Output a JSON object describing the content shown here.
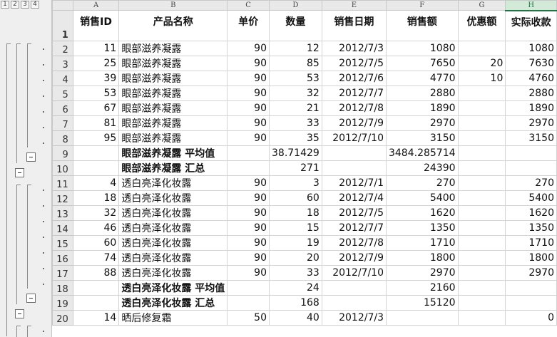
{
  "outline": {
    "levels": [
      "1",
      "2",
      "3",
      "4"
    ]
  },
  "columns": [
    "A",
    "B",
    "C",
    "D",
    "E",
    "F",
    "G",
    "H"
  ],
  "selected_column": "H",
  "header": {
    "row_number": "1",
    "cells": [
      "销售ID",
      "产品名称",
      "单价",
      "数量",
      "销售日期",
      "销售额",
      "优惠额",
      "实际收款"
    ]
  },
  "rows": [
    {
      "rn": "2",
      "kind": "data",
      "a": "11",
      "b": "眼部滋养凝露",
      "c": "90",
      "d": "12",
      "e": "2012/7/3",
      "f": "1080",
      "g": "",
      "h": "1080"
    },
    {
      "rn": "3",
      "kind": "data",
      "a": "25",
      "b": "眼部滋养凝露",
      "c": "90",
      "d": "85",
      "e": "2012/7/5",
      "f": "7650",
      "g": "20",
      "h": "7630"
    },
    {
      "rn": "4",
      "kind": "data",
      "a": "39",
      "b": "眼部滋养凝露",
      "c": "90",
      "d": "53",
      "e": "2012/7/6",
      "f": "4770",
      "g": "10",
      "h": "4760"
    },
    {
      "rn": "5",
      "kind": "data",
      "a": "53",
      "b": "眼部滋养凝露",
      "c": "90",
      "d": "32",
      "e": "2012/7/7",
      "f": "2880",
      "g": "",
      "h": "2880"
    },
    {
      "rn": "6",
      "kind": "data",
      "a": "67",
      "b": "眼部滋养凝露",
      "c": "90",
      "d": "21",
      "e": "2012/7/8",
      "f": "1890",
      "g": "",
      "h": "1890"
    },
    {
      "rn": "7",
      "kind": "data",
      "a": "81",
      "b": "眼部滋养凝露",
      "c": "90",
      "d": "33",
      "e": "2012/7/9",
      "f": "2970",
      "g": "",
      "h": "2970"
    },
    {
      "rn": "8",
      "kind": "data",
      "a": "95",
      "b": "眼部滋养凝露",
      "c": "90",
      "d": "35",
      "e": "2012/7/10",
      "f": "3150",
      "g": "",
      "h": "3150"
    },
    {
      "rn": "9",
      "kind": "sum",
      "a": "",
      "b": "眼部滋养凝露 平均值",
      "c": "",
      "d": "38.71429",
      "e": "",
      "f": "3484.285714",
      "g": "",
      "h": ""
    },
    {
      "rn": "10",
      "kind": "sum",
      "a": "",
      "b": "眼部滋养凝露 汇总",
      "c": "",
      "d": "271",
      "e": "",
      "f": "24390",
      "g": "",
      "h": ""
    },
    {
      "rn": "11",
      "kind": "data",
      "a": "4",
      "b": "透白亮泽化妆露",
      "c": "90",
      "d": "3",
      "e": "2012/7/1",
      "f": "270",
      "g": "",
      "h": "270"
    },
    {
      "rn": "12",
      "kind": "data",
      "a": "18",
      "b": "透白亮泽化妆露",
      "c": "90",
      "d": "60",
      "e": "2012/7/4",
      "f": "5400",
      "g": "",
      "h": "5400"
    },
    {
      "rn": "13",
      "kind": "data",
      "a": "32",
      "b": "透白亮泽化妆露",
      "c": "90",
      "d": "18",
      "e": "2012/7/5",
      "f": "1620",
      "g": "",
      "h": "1620"
    },
    {
      "rn": "14",
      "kind": "data",
      "a": "46",
      "b": "透白亮泽化妆露",
      "c": "90",
      "d": "15",
      "e": "2012/7/7",
      "f": "1350",
      "g": "",
      "h": "1350"
    },
    {
      "rn": "15",
      "kind": "data",
      "a": "60",
      "b": "透白亮泽化妆露",
      "c": "90",
      "d": "19",
      "e": "2012/7/8",
      "f": "1710",
      "g": "",
      "h": "1710"
    },
    {
      "rn": "16",
      "kind": "data",
      "a": "74",
      "b": "透白亮泽化妆露",
      "c": "90",
      "d": "20",
      "e": "2012/7/9",
      "f": "1800",
      "g": "",
      "h": "1800"
    },
    {
      "rn": "17",
      "kind": "data",
      "a": "88",
      "b": "透白亮泽化妆露",
      "c": "90",
      "d": "33",
      "e": "2012/7/10",
      "f": "2970",
      "g": "",
      "h": "2970"
    },
    {
      "rn": "18",
      "kind": "sum",
      "a": "",
      "b": "透白亮泽化妆露 平均值",
      "c": "",
      "d": "24",
      "e": "",
      "f": "2160",
      "g": "",
      "h": ""
    },
    {
      "rn": "19",
      "kind": "sum",
      "a": "",
      "b": "透白亮泽化妆露 汇总",
      "c": "",
      "d": "168",
      "e": "",
      "f": "15120",
      "g": "",
      "h": ""
    },
    {
      "rn": "20",
      "kind": "data",
      "a": "14",
      "b": "晒后修复霜",
      "c": "50",
      "d": "40",
      "e": "2012/7/3",
      "f": "",
      "g": "",
      "h": "0"
    }
  ]
}
